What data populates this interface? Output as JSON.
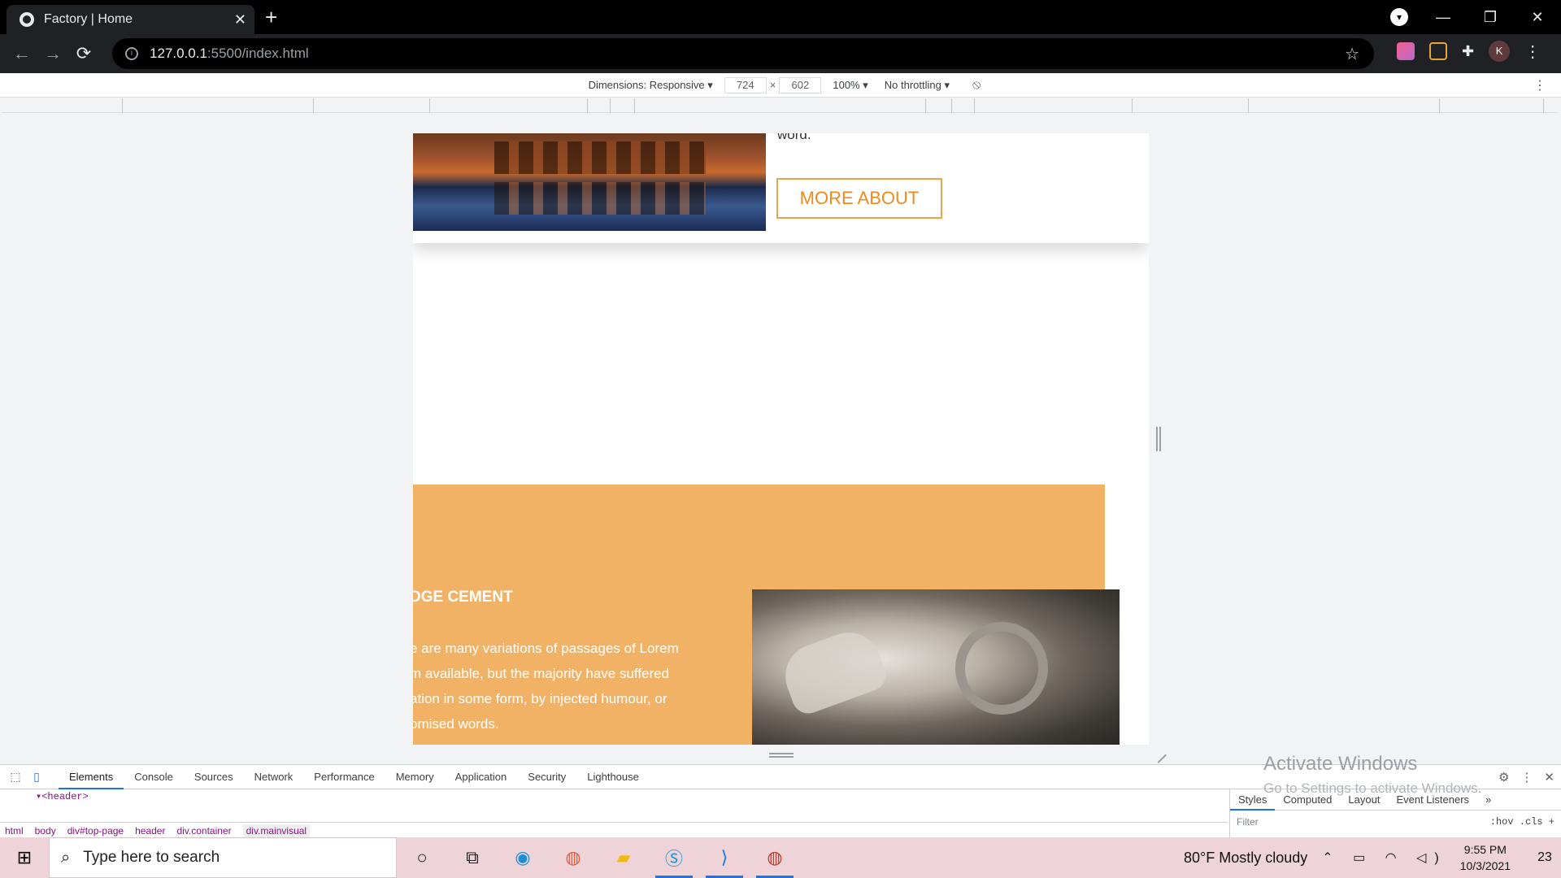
{
  "browser": {
    "tab_title": "Factory | Home",
    "tab_close": "✕",
    "new_tab": "+",
    "url_host": "127.0.0.1",
    "url_path": ":5500/index.html",
    "window_controls": [
      "—",
      "❐",
      "✕"
    ],
    "avatar_letter": "K"
  },
  "device_toolbar": {
    "dimensions_label": "Dimensions: Responsive ▾",
    "width": "724",
    "times": "×",
    "height": "602",
    "zoom": "100% ▾",
    "throttling": "No throttling ▾"
  },
  "page": {
    "word_text": "word.",
    "more_about_label": "MORE ABOUT",
    "cement_title": "DGE CEMENT",
    "cement_lines": [
      "e are many variations of passages of Lorem",
      "m available, but the majority have suffered",
      "ation in some form, by injected humour, or",
      "omised words."
    ]
  },
  "devtools": {
    "tabs": [
      "Elements",
      "Console",
      "Sources",
      "Network",
      "Performance",
      "Memory",
      "Application",
      "Security",
      "Lighthouse"
    ],
    "active_tab": "Elements",
    "dom_lines": [
      "▾<header>"
    ],
    "breadcrumbs": [
      "html",
      "body",
      "div#top-page",
      "header",
      "div.container",
      "div.mainvisual"
    ],
    "styles_tabs": [
      "Styles",
      "Computed",
      "Layout",
      "Event Listeners",
      "»"
    ],
    "filter_placeholder": "Filter",
    "filter_tools": ":hov .cls +"
  },
  "watermark": {
    "line1": "Activate Windows",
    "line2": "Go to Settings to activate Windows."
  },
  "taskbar": {
    "search_placeholder": "Type here to search",
    "weather": "80°F  Mostly cloudy",
    "time": "9:55 PM",
    "date": "10/3/2021",
    "notification_count": "23"
  },
  "colors": {
    "accent_orange": "#f2b266",
    "button_orange": "#f08a1c",
    "devtools_blue": "#1a73e8"
  }
}
